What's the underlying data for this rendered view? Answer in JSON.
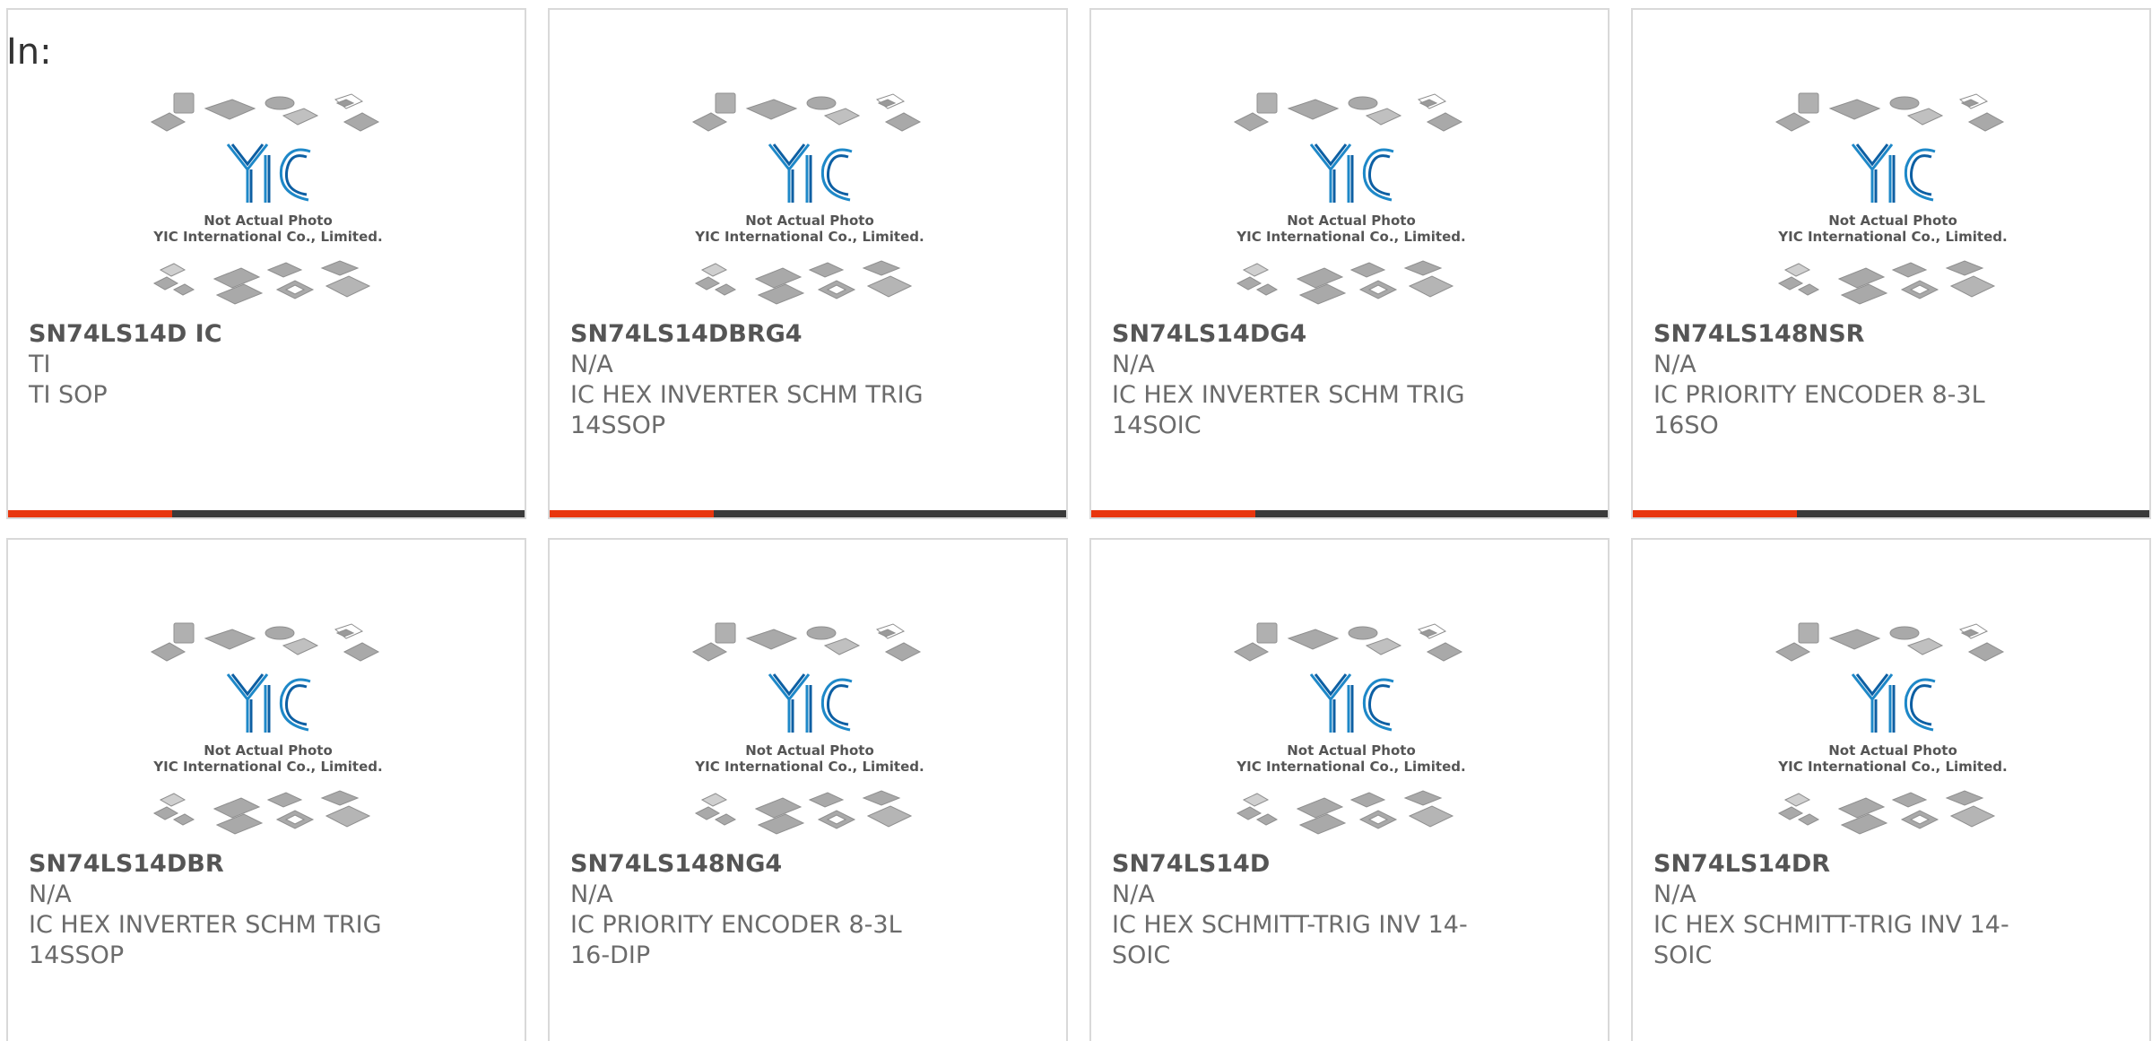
{
  "in_label": "In:",
  "colors": {
    "accent": "#e8360e",
    "bar": "#3a3a3a",
    "logo_blue": "#1e88c8"
  },
  "photo": {
    "line1": "Not Actual Photo",
    "line2": "YIC International Co., Limited.",
    "logo_text": "YIC"
  },
  "products": [
    {
      "part": "SN74LS14D IC",
      "manufacturer": "TI",
      "description": "TI SOP"
    },
    {
      "part": "SN74LS14DBRG4",
      "manufacturer": "N/A",
      "description": "IC HEX INVERTER SCHM TRIG 14SSOP"
    },
    {
      "part": "SN74LS14DG4",
      "manufacturer": "N/A",
      "description": "IC HEX INVERTER SCHM TRIG 14SOIC"
    },
    {
      "part": "SN74LS148NSR",
      "manufacturer": "N/A",
      "description": "IC PRIORITY ENCODER 8-3L 16SO"
    },
    {
      "part": "SN74LS14DBR",
      "manufacturer": "N/A",
      "description": "IC HEX INVERTER SCHM TRIG 14SSOP"
    },
    {
      "part": "SN74LS148NG4",
      "manufacturer": "N/A",
      "description": "IC PRIORITY ENCODER 8-3L 16-DIP"
    },
    {
      "part": "SN74LS14D",
      "manufacturer": "N/A",
      "description": "IC HEX SCHMITT-TRIG INV 14-SOIC"
    },
    {
      "part": "SN74LS14DR",
      "manufacturer": "N/A",
      "description": "IC HEX SCHMITT-TRIG INV 14-SOIC"
    }
  ]
}
